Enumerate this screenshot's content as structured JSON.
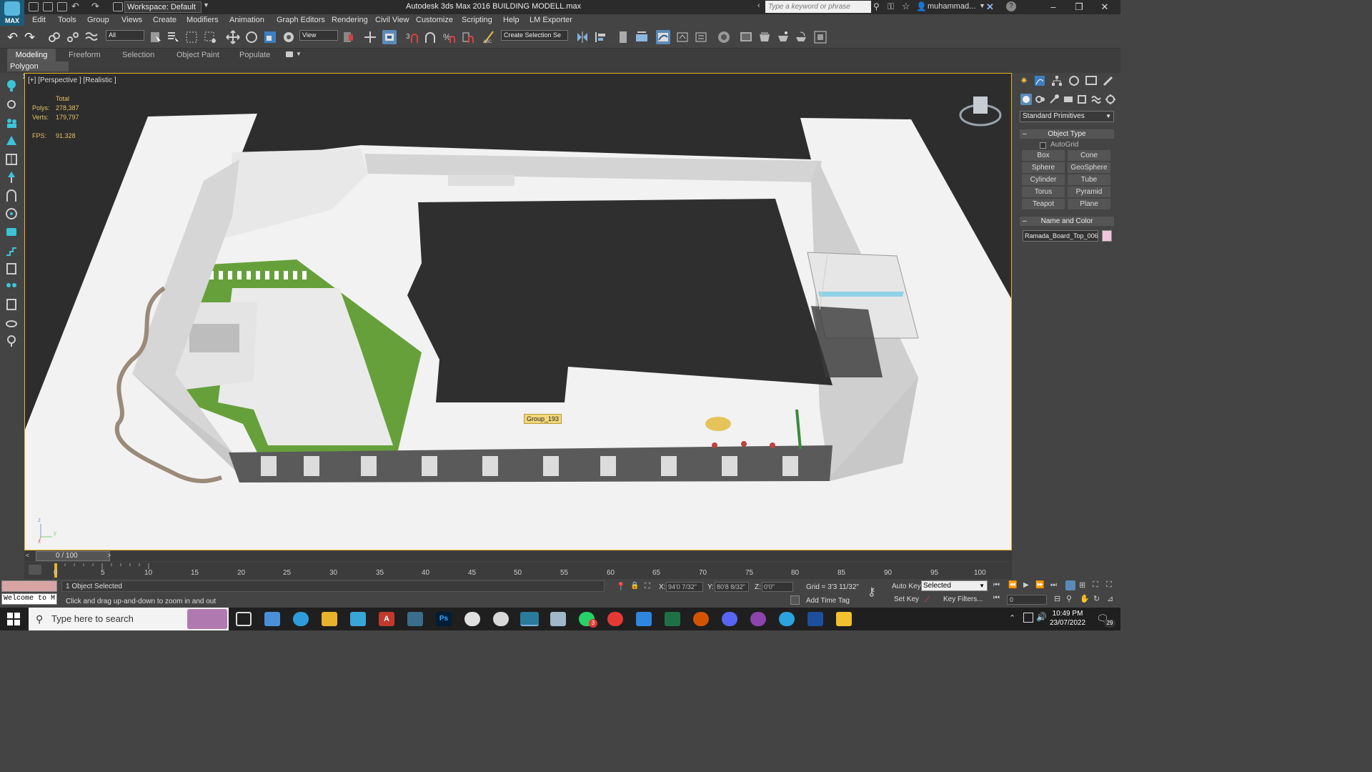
{
  "app": {
    "logo_text": "MAX",
    "title": "Autodesk 3ds Max 2016    BUILDING MODELL.max",
    "workspace": "Workspace: Default",
    "search_placeholder": "Type a keyword or phrase",
    "user": "muhammad..."
  },
  "menu": [
    "Edit",
    "Tools",
    "Group",
    "Views",
    "Create",
    "Modifiers",
    "Animation",
    "Graph Editors",
    "Rendering",
    "Civil View",
    "Customize",
    "Scripting",
    "Help",
    "LM Exporter"
  ],
  "toolbar": {
    "selection_filter": "All",
    "ref_coord": "View",
    "selection_set": "Create Selection Se"
  },
  "ribbon": {
    "tabs": [
      "Modeling",
      "Freeform",
      "Selection",
      "Object Paint",
      "Populate"
    ],
    "active_tab": "Modeling",
    "panel_label": "Polygon Modeling"
  },
  "viewport": {
    "label": "[+] [Perspective ] [Realistic ]",
    "stats": {
      "total_label": "Total",
      "polys_label": "Polys:",
      "polys": "278,387",
      "verts_label": "Verts:",
      "verts": "179,797",
      "fps_label": "FPS:",
      "fps": "91.328"
    },
    "object_tooltip": "Group_193",
    "axis_z": "z",
    "axis_y": "y",
    "axis_x": "x",
    "gizmo_z": "z"
  },
  "command_panel": {
    "dropdown": "Standard Primitives",
    "object_type_title": "Object Type",
    "autogrid": "AutoGrid",
    "primitives": [
      "Box",
      "Cone",
      "Sphere",
      "GeoSphere",
      "Cylinder",
      "Tube",
      "Torus",
      "Pyramid",
      "Teapot",
      "Plane"
    ],
    "name_color_title": "Name and Color",
    "object_name": "Ramada_Board_Top_006",
    "object_color": "#f2c5dc"
  },
  "timeline": {
    "frame_label": "0 / 100",
    "ticks": [
      "0",
      "5",
      "10",
      "15",
      "20",
      "25",
      "30",
      "35",
      "40",
      "45",
      "50",
      "55",
      "60",
      "65",
      "70",
      "75",
      "80",
      "85",
      "90",
      "95",
      "100"
    ]
  },
  "status": {
    "welcome": "Welcome to M",
    "selection_info": "1 Object Selected",
    "prompt": "Click and drag up-and-down to zoom in and out",
    "x_label": "X:",
    "x_value": "94'0 7/32\"",
    "y_label": "Y:",
    "y_value": "80'8 8/32\"",
    "z_label": "Z:",
    "z_value": "0'0\"",
    "grid": "Grid = 3'3 11/32\"",
    "add_time_tag": "Add Time Tag",
    "auto_key": "Auto Key",
    "set_key": "Set Key",
    "key_mode": "Selected",
    "key_filters": "Key Filters...",
    "frame_value": "0"
  },
  "taskbar": {
    "search_placeholder": "Type here to search",
    "time": "10:49 PM",
    "date": "23/07/2022",
    "notification_count": "29",
    "badge_count": "3"
  }
}
